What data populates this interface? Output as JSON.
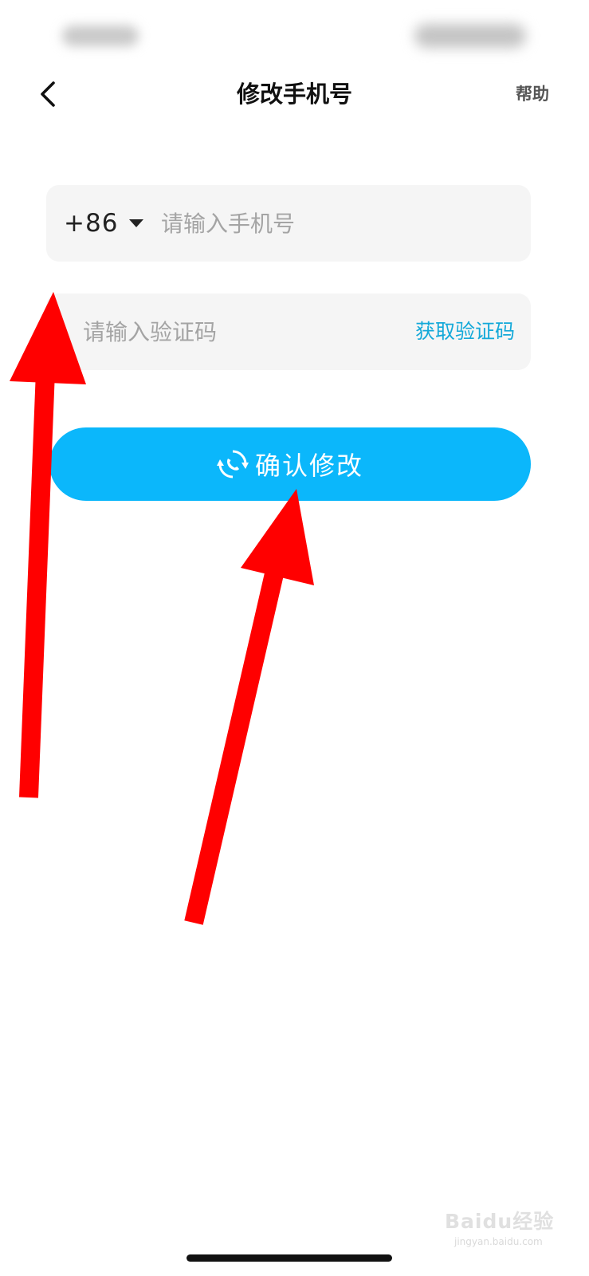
{
  "nav": {
    "title": "修改手机号",
    "help_label": "帮助"
  },
  "phone": {
    "country_code": "+86",
    "placeholder": "请输入手机号"
  },
  "code": {
    "placeholder": "请输入验证码",
    "get_code_label": "获取验证码"
  },
  "confirm": {
    "label": "确认修改"
  },
  "icons": {
    "back": "chevron-left-icon",
    "country_dropdown": "caret-down-icon",
    "confirm": "phone-refresh-icon"
  },
  "colors": {
    "accent": "#0bb7fb",
    "link": "#14a9d9",
    "field_bg": "#f5f5f5",
    "annotation_arrow": "#ff0000"
  },
  "watermark": {
    "brand": "Baidu经验",
    "site": "jingyan.baidu.com"
  }
}
